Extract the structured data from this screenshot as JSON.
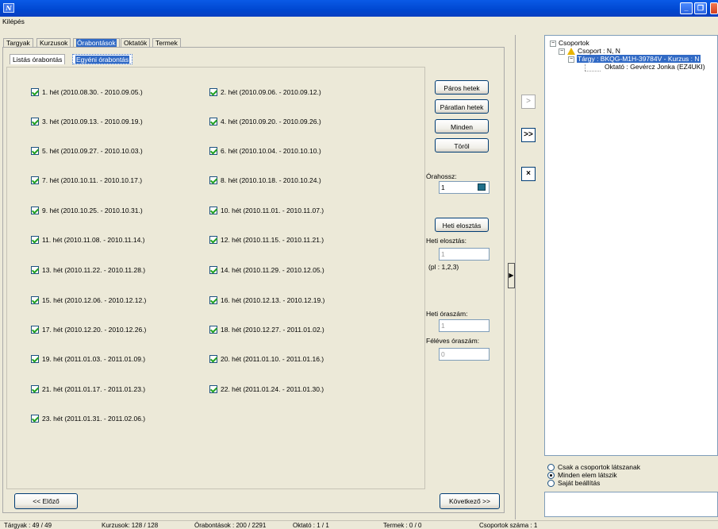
{
  "window": {
    "icon_text": "N",
    "minimize": "_",
    "maximize": "❐",
    "close": ""
  },
  "menu": {
    "exit": "Kilépés"
  },
  "tabs": [
    "Targyak",
    "Kurzusok",
    "Órabontások",
    "Oktatók",
    "Termek"
  ],
  "subtabs": [
    "Listás órabontás",
    "Egyéni órabontás"
  ],
  "weeks": [
    "1. hét  (2010.08.30. - 2010.09.05.)",
    "2. hét  (2010.09.06. - 2010.09.12.)",
    "3. hét  (2010.09.13. - 2010.09.19.)",
    "4. hét  (2010.09.20. - 2010.09.26.)",
    "5. hét  (2010.09.27. - 2010.10.03.)",
    "6. hét  (2010.10.04. - 2010.10.10.)",
    "7. hét  (2010.10.11. - 2010.10.17.)",
    "8. hét  (2010.10.18. - 2010.10.24.)",
    "9. hét  (2010.10.25. - 2010.10.31.)",
    "10. hét  (2010.11.01. - 2010.11.07.)",
    "11. hét  (2010.11.08. - 2010.11.14.)",
    "12. hét  (2010.11.15. - 2010.11.21.)",
    "13. hét  (2010.11.22. - 2010.11.28.)",
    "14. hét  (2010.11.29. - 2010.12.05.)",
    "15. hét  (2010.12.06. - 2010.12.12.)",
    "16. hét  (2010.12.13. - 2010.12.19.)",
    "17. hét  (2010.12.20. - 2010.12.26.)",
    "18. hét  (2010.12.27. - 2011.01.02.)",
    "19. hét  (2011.01.03. - 2011.01.09.)",
    "20. hét  (2011.01.10. - 2011.01.16.)",
    "21. hét  (2011.01.17. - 2011.01.23.)",
    "22. hét  (2011.01.24. - 2011.01.30.)",
    "23. hét  (2011.01.31. - 2011.02.06.)"
  ],
  "buttons": {
    "even_weeks": "Páros hetek",
    "odd_weeks": "Páratlan hetek",
    "all": "Minden",
    "delete": "Töröl",
    "weekly_distribution": "Heti elosztás",
    "prev": "<< Előző",
    "next": "Következő >>"
  },
  "fields": {
    "hour_length_label": "Órahossz:",
    "hour_length_value": "1",
    "weekly_distribution_label": "Heti elosztás:",
    "weekly_distribution_value": "1",
    "weekly_distribution_hint": "(pl : 1,2,3)",
    "weekly_hours_label": "Heti óraszám:",
    "weekly_hours_value": "1",
    "semester_hours_label": "Féléves óraszám:",
    "semester_hours_value": "0"
  },
  "side_buttons": {
    "move": ">",
    "move_all": ">>",
    "remove": "×",
    "collapse": "▶"
  },
  "tree": {
    "root": "Csoportok",
    "group": "Csoport : N, N",
    "subject": "Tárgy : BKQG-M1H-39784V - Kurzus : N",
    "teacher": "Oktató : Gevércz Jonka (EZ4UKI)"
  },
  "filter_options": [
    "Csak a csoportok látszanak",
    "Minden elem látszik",
    "Saját beállítás"
  ],
  "filter_selected": 1,
  "status": {
    "subjects": "Tárgyak : 49 / 49",
    "courses": "Kurzusok: 128 / 128",
    "splits": "Órabontások : 200 / 2291",
    "teachers": "Oktató : 1 / 1",
    "rooms": "Termek : 0 / 0",
    "groups": "Csoportok száma : 1"
  }
}
